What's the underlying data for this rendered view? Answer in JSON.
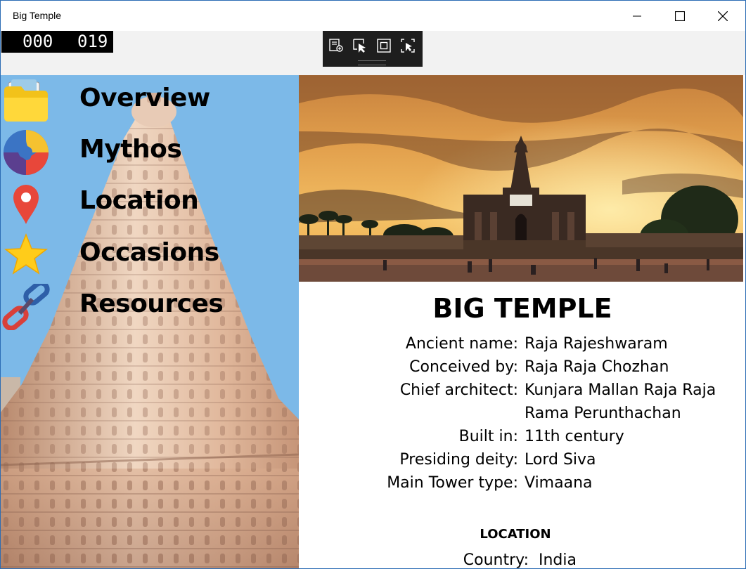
{
  "window": {
    "title": "Big Temple",
    "controls": [
      "minimize-icon",
      "maximize-icon",
      "close-icon"
    ]
  },
  "frame_counter": {
    "left": "000",
    "right": "019"
  },
  "debug_toolbar": {
    "buttons": [
      "live-visual-tree-icon",
      "select-element-icon",
      "display-layout-adorners-icon",
      "track-focused-element-icon"
    ]
  },
  "nav": {
    "items": [
      {
        "label": "Overview",
        "icon": "folder-icon"
      },
      {
        "label": "Mythos",
        "icon": "puzzle-icon"
      },
      {
        "label": "Location",
        "icon": "map-pin-icon"
      },
      {
        "label": "Occasions",
        "icon": "star-icon"
      },
      {
        "label": "Resources",
        "icon": "link-icon"
      }
    ]
  },
  "content": {
    "title": "BIG TEMPLE",
    "details": [
      {
        "label": "Ancient name:",
        "value": "Raja Rajeshwaram"
      },
      {
        "label": "Conceived by:",
        "value": "Raja Raja Chozhan"
      },
      {
        "label": "Chief architect:",
        "value": "Kunjara Mallan Raja Raja",
        "value2": "Rama Perunthachan"
      },
      {
        "label": "Built in:",
        "value": "11th century"
      },
      {
        "label": "Presiding deity:",
        "value": "Lord Siva"
      },
      {
        "label": "Main Tower type:",
        "value": "Vimaana"
      }
    ],
    "location_heading": "LOCATION",
    "location": [
      {
        "label": "Country:",
        "value": "India"
      }
    ]
  },
  "colors": {
    "nav_background": "#7cb9e8",
    "title_bar": "#ffffff",
    "toolbar_strip": "#f2f2f2",
    "window_border": "#2b6cb4"
  }
}
